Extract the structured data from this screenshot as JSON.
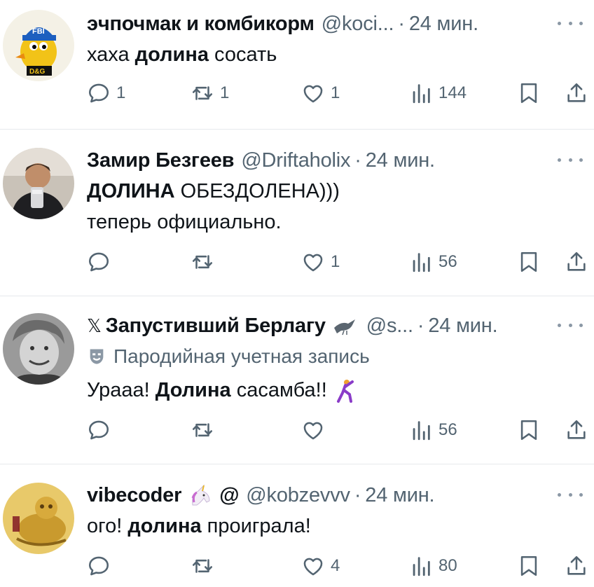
{
  "tweets": [
    {
      "name": "эчпочмак и комбикорм",
      "handle": "@koci...",
      "time": "24 мин.",
      "avatar": "yellow-bird-cap-avatar",
      "avatar_text": "FBI",
      "avatar_badge": "D&G",
      "text_prefix": "хаха ",
      "text_bold": "долина",
      "text_suffix": " сосать",
      "replies": "1",
      "reposts": "1",
      "likes": "1",
      "views": "144"
    },
    {
      "name": "Замир Безгеев",
      "handle": "@Driftaholix",
      "time": "24 мин.",
      "avatar": "person-selfie-avatar",
      "text_bold": "ДОЛИНА",
      "text_suffix": " ОБЕЗДОЛЕНА)))",
      "text_line2": "теперь официально.",
      "replies": "",
      "reposts": "",
      "likes": "1",
      "views": "56"
    },
    {
      "x_mark": "𝕏",
      "name": "Запустивший Берлагу",
      "handle": "@s...",
      "time": "24 мин.",
      "avatar": "bw-portrait-avatar",
      "parody_label": "Пародийная учетная запись",
      "text_prefix": "Урааа! ",
      "text_bold": "Долина",
      "text_suffix": " сасамба!!",
      "replies": "",
      "reposts": "",
      "likes": "",
      "views": "56"
    },
    {
      "name": "vibecoder",
      "at_sign": "@",
      "handle": "@kobzevvv",
      "time": "24 мин.",
      "avatar": "golden-figure-avatar",
      "text_prefix": "ого! ",
      "text_bold": "долина",
      "text_suffix": " проиграла!",
      "replies": "",
      "reposts": "",
      "likes": "4",
      "views": "80"
    }
  ],
  "separator": "·",
  "colors": {
    "text": "#0f1419",
    "secondary": "#536471",
    "divider": "#e6e9ec",
    "parody_icon": "#8b98a5"
  }
}
